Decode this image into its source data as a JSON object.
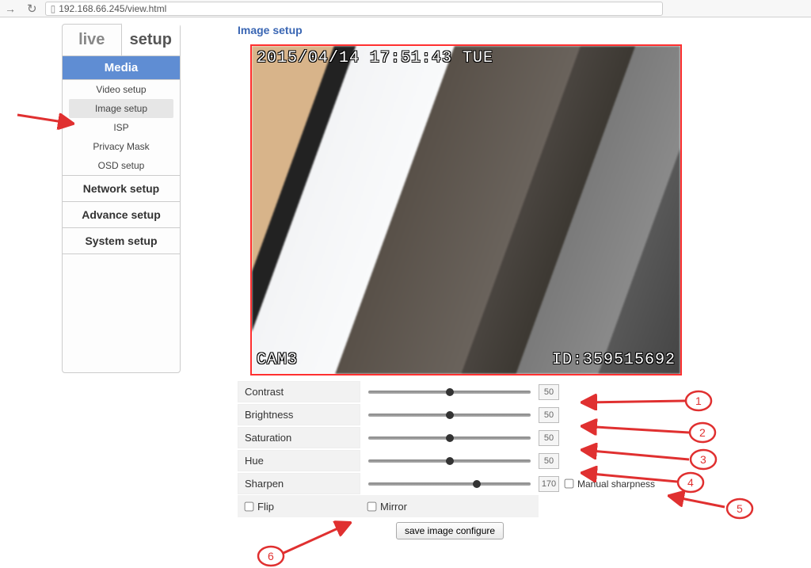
{
  "browser": {
    "url": "192.168.66.245/view.html"
  },
  "tabs": {
    "live": "live",
    "setup": "setup"
  },
  "sidebar": {
    "media_header": "Media",
    "items": [
      "Video setup",
      "Image setup",
      "ISP",
      "Privacy Mask",
      "OSD setup"
    ],
    "sections": [
      "Network setup",
      "Advance setup",
      "System setup"
    ]
  },
  "page": {
    "title": "Image setup"
  },
  "osd": {
    "timestamp": "2015/04/14 17:51:43 TUE",
    "cam": "CAM3",
    "id": "ID:359515692"
  },
  "controls": {
    "contrast": {
      "label": "Contrast",
      "value": "50",
      "pos": 50
    },
    "brightness": {
      "label": "Brightness",
      "value": "50",
      "pos": 50
    },
    "saturation": {
      "label": "Saturation",
      "value": "50",
      "pos": 50
    },
    "hue": {
      "label": "Hue",
      "value": "50",
      "pos": 50
    },
    "sharpen": {
      "label": "Sharpen",
      "value": "170",
      "pos": 67,
      "manual_label": "Manual sharpness"
    },
    "flip": "Flip",
    "mirror": "Mirror",
    "save": "save image configure"
  },
  "annotations": {
    "n1": "1",
    "n2": "2",
    "n3": "3",
    "n4": "4",
    "n5": "5",
    "n6": "6"
  }
}
